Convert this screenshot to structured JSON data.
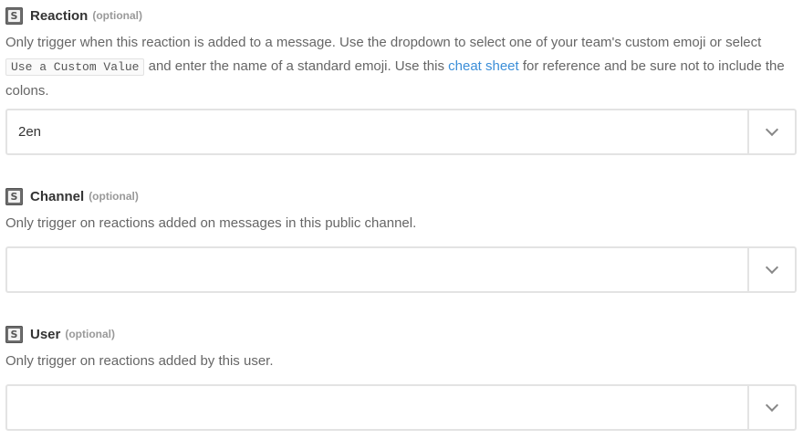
{
  "fields": [
    {
      "label": "Reaction",
      "optional": "(optional)",
      "app_icon_letter": "S",
      "help": {
        "part1": "Only trigger when this reaction is added to a message. Use the dropdown to select one of your team's custom emoji or select",
        "code": "Use a Custom Value",
        "part2": "and enter the name of a standard emoji. Use this",
        "link": "cheat sheet",
        "part3": "for reference and be sure not to include the colons."
      },
      "value": "2en"
    },
    {
      "label": "Channel",
      "optional": "(optional)",
      "app_icon_letter": "S",
      "help": "Only trigger on reactions added on messages in this public channel.",
      "value": ""
    },
    {
      "label": "User",
      "optional": "(optional)",
      "app_icon_letter": "S",
      "help": "Only trigger on reactions added by this user.",
      "value": ""
    }
  ],
  "icons": {
    "app": "slack-app-icon",
    "dropdown": "chevron-down-icon"
  },
  "colors": {
    "link": "#3b8ed8",
    "label": "#333333",
    "help": "#666666",
    "border": "#e3e3e3"
  }
}
